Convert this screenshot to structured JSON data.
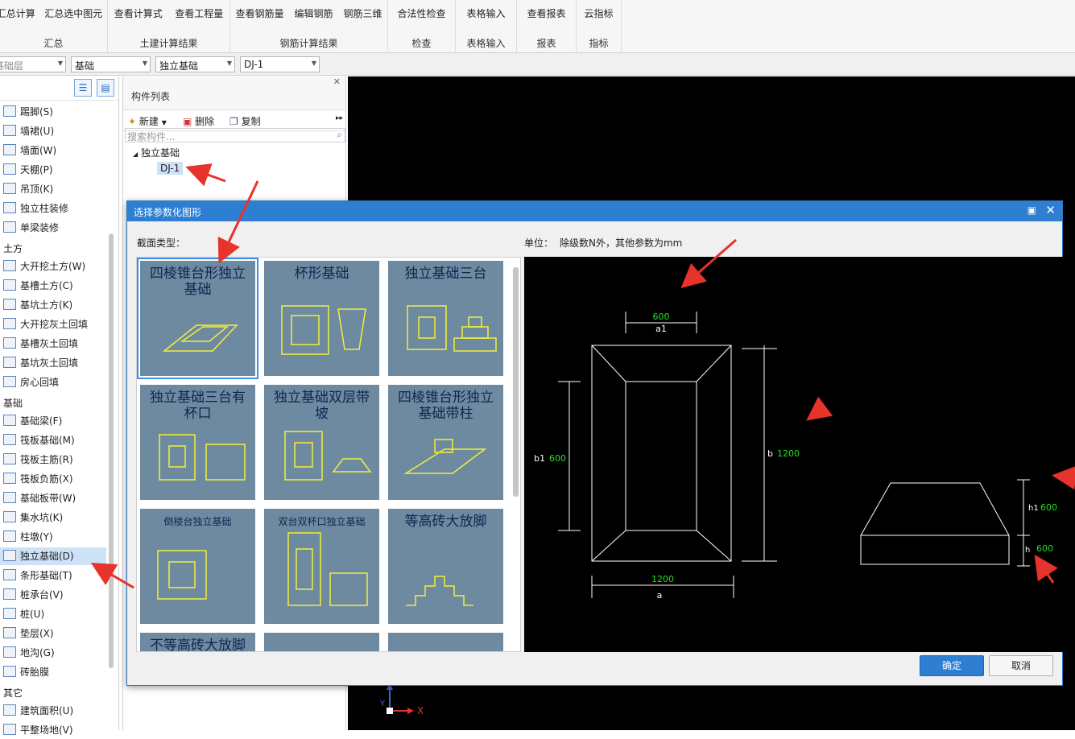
{
  "ribbon": {
    "groups": [
      {
        "name": "汇总",
        "items": [
          "汇总计算",
          "汇总选中图元"
        ]
      },
      {
        "name": "土建计算结果",
        "items": [
          "查看计算式",
          "查看工程量"
        ]
      },
      {
        "name": "钢筋计算结果",
        "items": [
          "查看钢筋量",
          "编辑钢筋",
          "钢筋三维"
        ]
      },
      {
        "name": "检查",
        "items": [
          "合法性检查"
        ]
      },
      {
        "name": "表格输入",
        "items": [
          "表格输入"
        ]
      },
      {
        "name": "报表",
        "items": [
          "查看报表"
        ]
      },
      {
        "name": "指标",
        "items": [
          "云指标"
        ]
      }
    ]
  },
  "selectors": [
    "基础层",
    "基础",
    "独立基础",
    "DJ-1"
  ],
  "leftnav": {
    "items": [
      {
        "label": "踢脚(S)",
        "type": "item"
      },
      {
        "label": "墙裙(U)",
        "type": "item"
      },
      {
        "label": "墙面(W)",
        "type": "item"
      },
      {
        "label": "天棚(P)",
        "type": "item"
      },
      {
        "label": "吊顶(K)",
        "type": "item"
      },
      {
        "label": "独立柱装修",
        "type": "item"
      },
      {
        "label": "单梁装修",
        "type": "item"
      },
      {
        "label": "土方",
        "type": "cat"
      },
      {
        "label": "大开挖土方(W)",
        "type": "item"
      },
      {
        "label": "基槽土方(C)",
        "type": "item"
      },
      {
        "label": "基坑土方(K)",
        "type": "item"
      },
      {
        "label": "大开挖灰土回填",
        "type": "item"
      },
      {
        "label": "基槽灰土回填",
        "type": "item"
      },
      {
        "label": "基坑灰土回填",
        "type": "item"
      },
      {
        "label": "房心回填",
        "type": "item"
      },
      {
        "label": "基础",
        "type": "cat"
      },
      {
        "label": "基础梁(F)",
        "type": "item"
      },
      {
        "label": "筏板基础(M)",
        "type": "item"
      },
      {
        "label": "筏板主筋(R)",
        "type": "item"
      },
      {
        "label": "筏板负筋(X)",
        "type": "item"
      },
      {
        "label": "基础板带(W)",
        "type": "item"
      },
      {
        "label": "集水坑(K)",
        "type": "item"
      },
      {
        "label": "柱墩(Y)",
        "type": "item"
      },
      {
        "label": "独立基础(D)",
        "type": "item",
        "selected": true
      },
      {
        "label": "条形基础(T)",
        "type": "item"
      },
      {
        "label": "桩承台(V)",
        "type": "item"
      },
      {
        "label": "桩(U)",
        "type": "item"
      },
      {
        "label": "垫层(X)",
        "type": "item"
      },
      {
        "label": "地沟(G)",
        "type": "item"
      },
      {
        "label": "砖胎膜",
        "type": "item"
      },
      {
        "label": "其它",
        "type": "cat"
      },
      {
        "label": "建筑面积(U)",
        "type": "item"
      },
      {
        "label": "平整场地(V)",
        "type": "item"
      }
    ]
  },
  "component_panel": {
    "title": "构件列表",
    "toolbar": {
      "new": "新建",
      "delete": "删除",
      "copy": "复制"
    },
    "search_placeholder": "搜索构件...",
    "tree_root": "独立基础",
    "tree_child": "DJ-1"
  },
  "dialog": {
    "title": "选择参数化图形",
    "section_label": "截面类型：",
    "unit_label": "单位：",
    "unit_text": "除级数N外，其他参数为mm",
    "ok": "确定",
    "cancel": "取消",
    "shapes": [
      "四棱锥台形独立基础",
      "杯形基础",
      "独立基础三台",
      "独立基础三台有杯口",
      "独立基础双层带坡",
      "四棱锥台形独立基础带柱",
      "倒棱台独立基础",
      "双台双杯口独立基础",
      "等高砖大放脚",
      "不等高砖大放脚",
      "",
      ""
    ],
    "preview": {
      "a1": "600",
      "a1_name": "a1",
      "b1": "600",
      "b1_name": "b1",
      "b": "1200",
      "b_name": "b",
      "a": "1200",
      "a_name": "a",
      "h1": "600",
      "h1_name": "h1",
      "h": "600",
      "h_name": "h"
    }
  },
  "colors": {
    "accent": "#2e7fd2",
    "dim_value": "#22e022",
    "arrow": "#e8322c"
  }
}
